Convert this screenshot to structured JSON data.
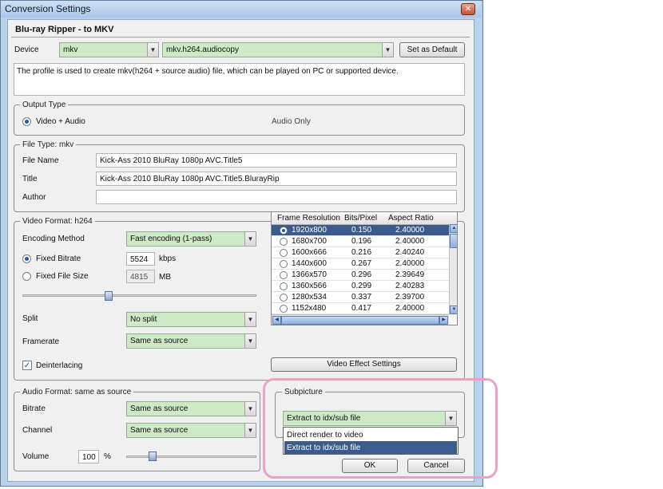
{
  "window": {
    "title": "Conversion Settings"
  },
  "profile": {
    "header": "Blu-ray Ripper - to MKV",
    "device_label": "Device",
    "device_value": "mkv",
    "profile_value": "mkv.h264.audiocopy",
    "set_default_label": "Set as Default",
    "description": "The profile is used to create mkv(h264 + source audio) file, which can be played on PC or supported device."
  },
  "output_type": {
    "legend": "Output Type",
    "video_audio": "Video + Audio",
    "audio_only": "Audio Only"
  },
  "file_type": {
    "legend": "File Type: mkv",
    "file_name_label": "File Name",
    "file_name_value": "Kick-Ass 2010 BluRay 1080p AVC.Title5",
    "title_label": "Title",
    "title_value": "Kick-Ass 2010 BluRay 1080p AVC.Title5.BlurayRip",
    "author_label": "Author",
    "author_value": ""
  },
  "video_format": {
    "legend": "Video Format: h264",
    "encoding_label": "Encoding Method",
    "encoding_value": "Fast encoding (1-pass)",
    "fixed_bitrate_label": "Fixed Bitrate",
    "fixed_bitrate_value": "5524",
    "kbps": "kbps",
    "fixed_size_label": "Fixed File Size",
    "fixed_size_value": "4815",
    "mb": "MB",
    "split_label": "Split",
    "split_value": "No split",
    "framerate_label": "Framerate",
    "framerate_value": "Same as source",
    "deinterlacing_label": "Deinterlacing",
    "effect_button": "Video Effect Settings",
    "table": {
      "headers": [
        "Frame Resolution",
        "Bits/Pixel",
        "Aspect Ratio"
      ],
      "rows": [
        [
          "1920x800",
          "0.150",
          "2.40000"
        ],
        [
          "1680x700",
          "0.196",
          "2.40000"
        ],
        [
          "1600x666",
          "0.216",
          "2.40240"
        ],
        [
          "1440x600",
          "0.267",
          "2.40000"
        ],
        [
          "1366x570",
          "0.296",
          "2.39649"
        ],
        [
          "1360x566",
          "0.299",
          "2.40283"
        ],
        [
          "1280x534",
          "0.337",
          "2.39700"
        ],
        [
          "1152x480",
          "0.417",
          "2.40000"
        ]
      ]
    }
  },
  "audio_format": {
    "legend": "Audio Format: same as source",
    "bitrate_label": "Bitrate",
    "bitrate_value": "Same as source",
    "channel_label": "Channel",
    "channel_value": "Same as source",
    "volume_label": "Volume",
    "volume_value": "100",
    "percent": "%"
  },
  "subpicture": {
    "legend": "Subpicture",
    "value": "Extract to idx/sub file",
    "options": [
      "Direct render to video",
      "Extract to idx/sub file"
    ]
  },
  "buttons": {
    "ok": "OK",
    "cancel": "Cancel"
  },
  "colors": {
    "combo_green": "#cde9c6",
    "selection": "#3b5b8c",
    "highlight_pink": "#e7a3c8"
  }
}
